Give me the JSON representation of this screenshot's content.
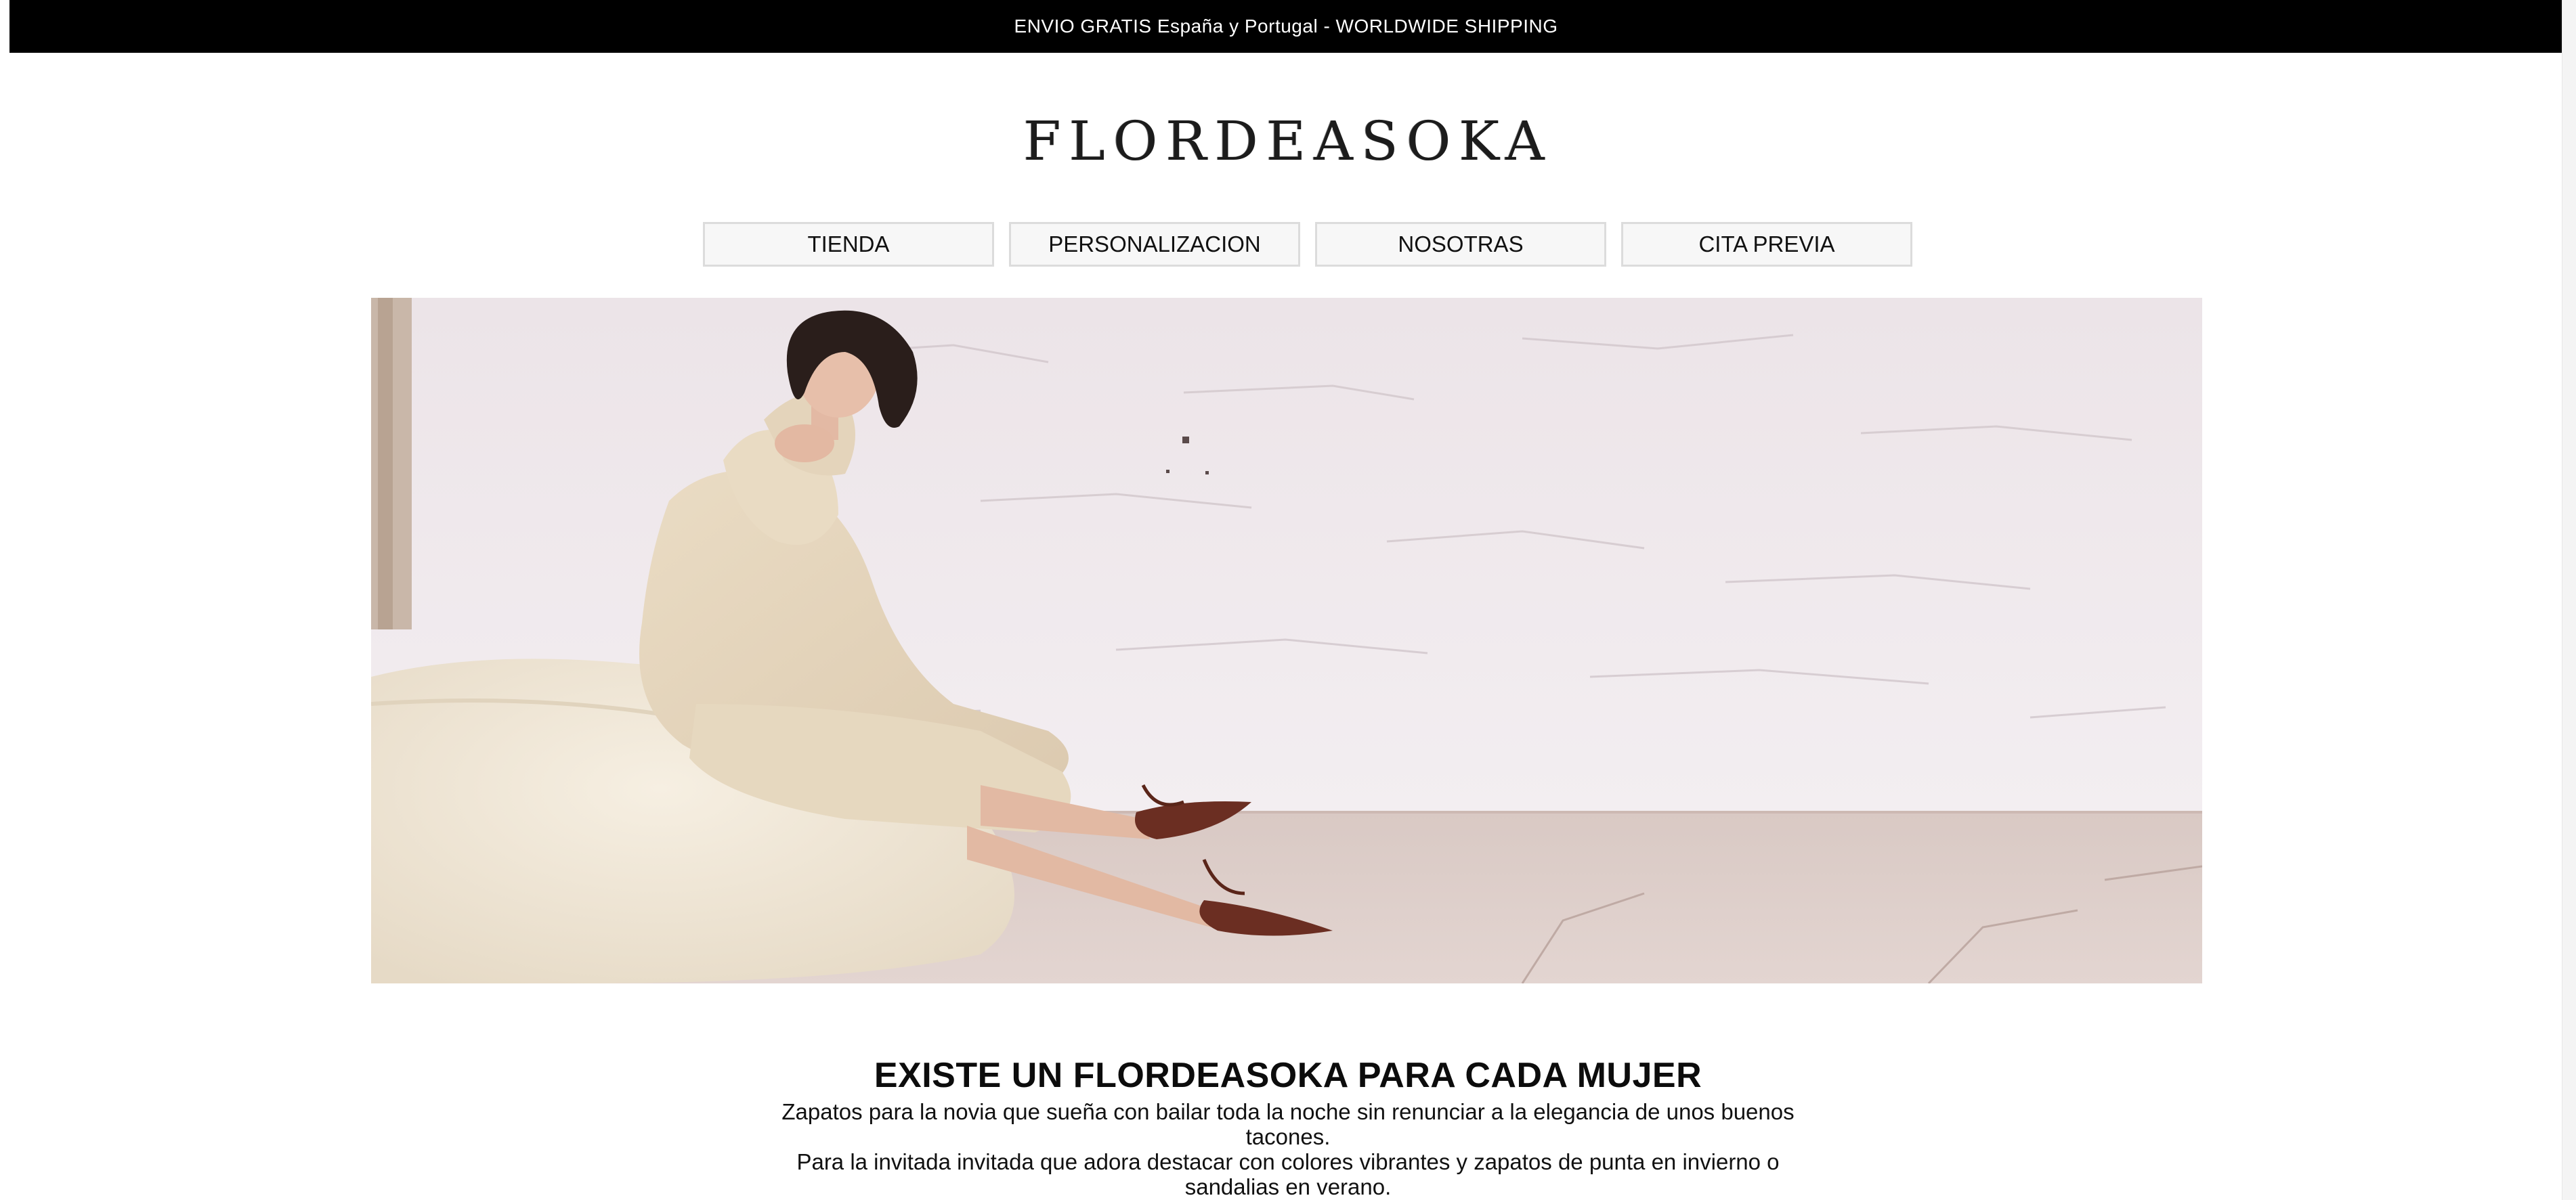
{
  "announcement": {
    "text": "ENVIO GRATIS España y Portugal - WORLDWIDE SHIPPING"
  },
  "brand": {
    "logo_text": "FLORDEASOKA"
  },
  "nav": {
    "items": [
      {
        "label": "TIENDA"
      },
      {
        "label": "PERSONALIZACION"
      },
      {
        "label": "NOSOTRAS"
      },
      {
        "label": "CITA PREVIA"
      }
    ]
  },
  "hero": {
    "image": "hero-photo-woman-seated-on-beanbag"
  },
  "intro": {
    "headline": "EXISTE UN FLORDEASOKA PARA CADA MUJER",
    "paragraph_1": "Zapatos para la novia que sueña con bailar toda la noche sin renunciar a la elegancia de unos buenos tacones.",
    "paragraph_2": "Para la invitada invitada que adora destacar con colores vibrantes y zapatos de punta en invierno o sandalias en verano."
  },
  "colors": {
    "announce_bg": "#000000",
    "announce_text": "#ffffff",
    "nav_bg": "#f7f7f7",
    "nav_border": "#dcdcdc",
    "shoe": "#6b2e22"
  }
}
